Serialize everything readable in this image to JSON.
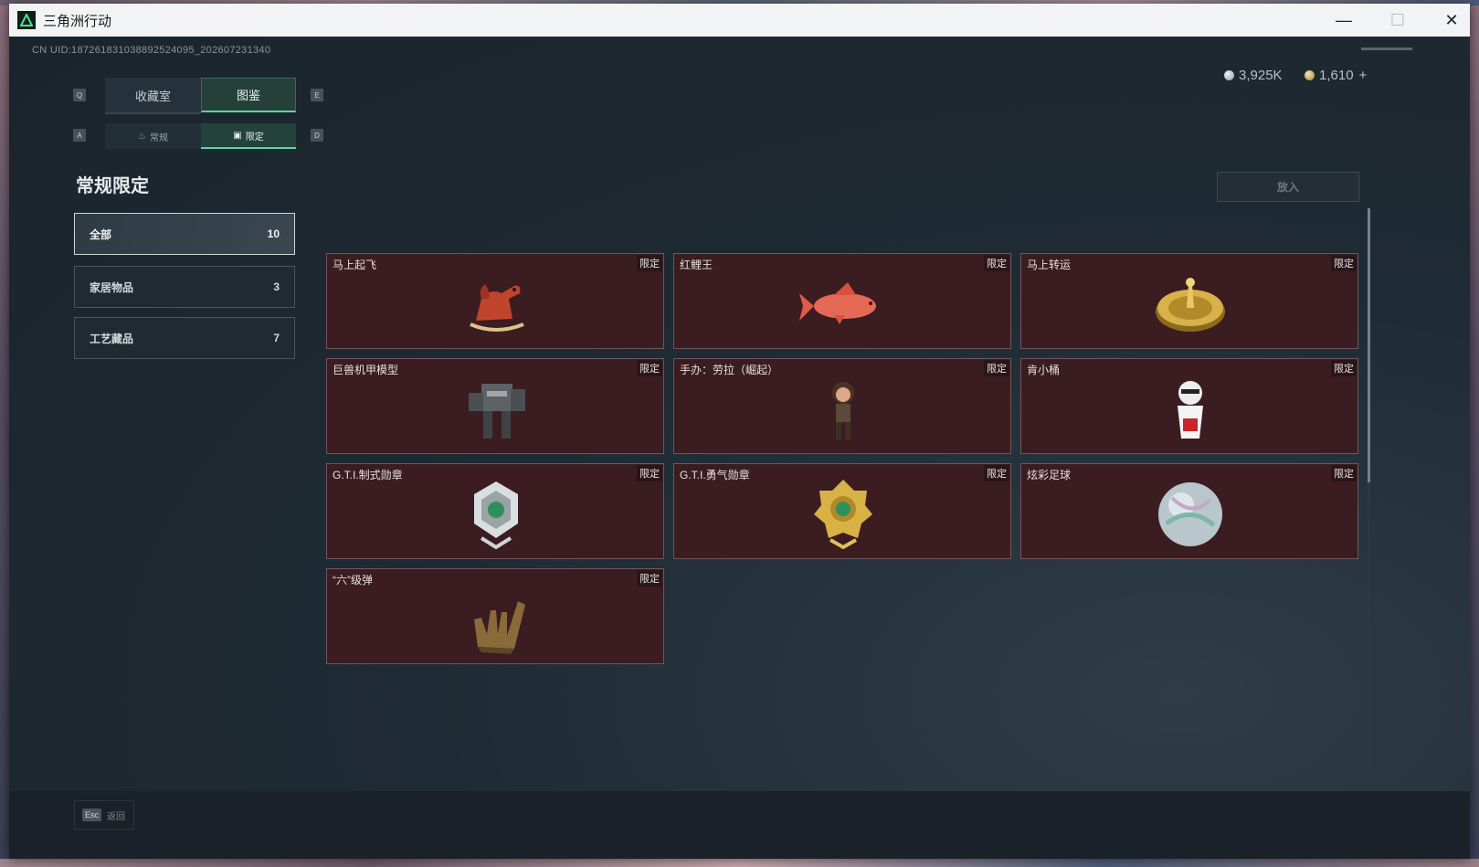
{
  "window": {
    "title": "三角洲行动"
  },
  "header": {
    "uid": "CN UID:1872618310388925240­95_202607231340",
    "currency_silver": "3,925K",
    "currency_gold": "1,610",
    "add_symbol": "+"
  },
  "keys": {
    "q": "Q",
    "e": "E",
    "a": "A",
    "d": "D"
  },
  "tabs": [
    {
      "label": "收藏室"
    },
    {
      "label": "图鉴"
    }
  ],
  "subtabs": [
    {
      "label": "常规"
    },
    {
      "label": "限定"
    }
  ],
  "section_title": "常规限定",
  "categories": [
    {
      "label": "全部",
      "count": "10"
    },
    {
      "label": "家居物品",
      "count": "3"
    },
    {
      "label": "工艺藏品",
      "count": "7"
    }
  ],
  "insert_button": "放入",
  "badge": "限定",
  "items": [
    {
      "name": "马上起飞",
      "icon": "rocking-horse-icon"
    },
    {
      "name": "红鲤王",
      "icon": "red-carp-icon"
    },
    {
      "name": "马上转运",
      "icon": "golden-wheel-icon"
    },
    {
      "name": "巨兽机甲模型",
      "icon": "mech-model-icon"
    },
    {
      "name": "手办：劳拉（崛起）",
      "icon": "figurine-icon"
    },
    {
      "name": "肯小桶",
      "icon": "mascot-bucket-icon"
    },
    {
      "name": "G.T.I.制式勋章",
      "icon": "silver-medal-icon"
    },
    {
      "name": "G.T.I.勇气勋章",
      "icon": "gold-medal-icon"
    },
    {
      "name": "炫彩足球",
      "icon": "iridescent-ball-icon"
    },
    {
      "name": "“六”级弹",
      "icon": "bullet-hand-icon"
    }
  ],
  "footer": {
    "esc_key": "Esc",
    "esc_label": "返回"
  }
}
